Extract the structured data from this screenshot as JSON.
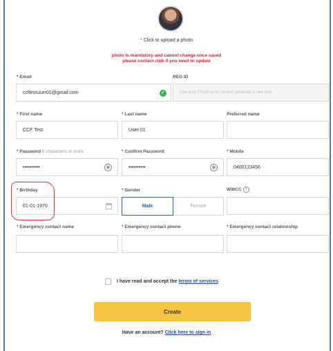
{
  "photo": {
    "upload_label": "Click to upload a photo"
  },
  "warning": {
    "line1": "photo is mandatory and cannot change once saved",
    "line2": "please contact club if you need to update"
  },
  "fields": {
    "email": {
      "label": "Email",
      "value": "ccftestuser01@gmail.com"
    },
    "reg_id": {
      "label": "REG ID",
      "placeholder": "Use your FFAID or let system generate a new one"
    },
    "first_name": {
      "label": "First name",
      "value": "CCF Test"
    },
    "last_name": {
      "label": "Last name",
      "value": "User 01"
    },
    "preferred_name": {
      "label": "Preferred name",
      "value": ""
    },
    "password": {
      "label": "Password",
      "hint": "6 characters or more",
      "value": "••••••••••"
    },
    "confirm_password": {
      "label": "Confirm Password",
      "value": "••••••••••"
    },
    "mobile": {
      "label": "Mobile",
      "value": "0400123456"
    },
    "birthday": {
      "label": "Birthday",
      "value": "01-01-1970"
    },
    "gender": {
      "label": "Gender",
      "options": [
        "Male",
        "Female"
      ],
      "selected": "Male"
    },
    "wwcc": {
      "label": "WWCC",
      "value": ""
    },
    "emergency_name": {
      "label": "Emergency contact name",
      "value": ""
    },
    "emergency_phone": {
      "label": "Emergency contact phone",
      "value": ""
    },
    "emergency_relationship": {
      "label": "Emergency contact relationship",
      "value": ""
    }
  },
  "required_marker": "*",
  "terms": {
    "prefix": "I have read and accept the",
    "link": "terms of services"
  },
  "create_label": "Create",
  "signin": {
    "prefix": "Have an account?",
    "link": "Click here to sign in"
  },
  "colors": {
    "accent": "#f5c440",
    "link": "#1f4f9a",
    "required": "#e0303a",
    "selected": "#2b5fb0",
    "frame": "#4a78c8"
  }
}
